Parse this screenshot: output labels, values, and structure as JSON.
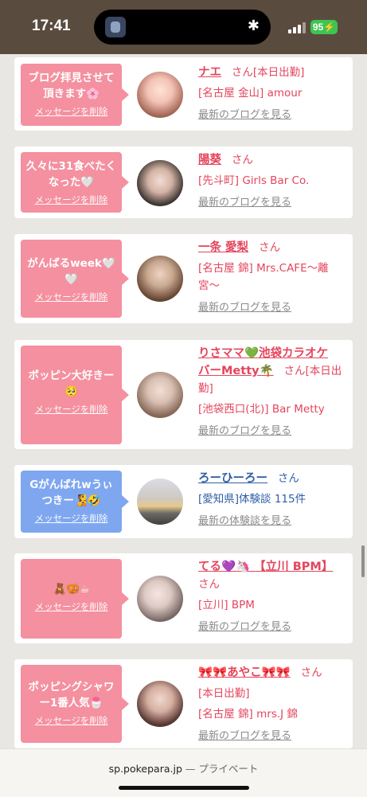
{
  "status_bar": {
    "time": "17:41",
    "battery": "95"
  },
  "cards": [
    {
      "message_lines": [
        "ブログ拝見させて",
        "頂きます🌸"
      ],
      "delete_label": "メッセージを削除",
      "message_color": "pink",
      "name_lines": [
        "ナエ"
      ],
      "honorific": "さん",
      "honorific_inline_text": "[本日出勤]",
      "details": [
        "[名古屋 金山] amour"
      ],
      "link": "最新のブログを見る"
    },
    {
      "message_lines": [
        "久々に31食べたく",
        "なった🤍"
      ],
      "delete_label": "メッセージを削除",
      "message_color": "pink",
      "name_lines": [
        "陽葵"
      ],
      "honorific": "さん",
      "details": [
        "[先斗町] Girls Bar Co."
      ],
      "link": "最新のブログを見る"
    },
    {
      "message_lines": [
        "がんばるweek🤍",
        "🤍"
      ],
      "delete_label": "メッセージを削除",
      "message_color": "pink",
      "name_lines": [
        "一条 愛梨"
      ],
      "honorific": "さん",
      "details": [
        "[名古屋 錦] Mrs.CAFE〜離",
        "宮〜"
      ],
      "link": "最新のブログを見る"
    },
    {
      "message_lines": [
        "ポッピン大好きー",
        "🥺"
      ],
      "delete_label": "メッセージを削除",
      "message_color": "pink",
      "name_lines": [
        "りさママ💚池袋カラオケ",
        "バーMetty🌴"
      ],
      "honorific": "さん",
      "honorific_inline_text": "[本日出",
      "details": [
        "勤]",
        "[池袋西口(北)] Bar Metty"
      ],
      "link": "最新のブログを見る"
    },
    {
      "message_lines": [
        "Gがんばれwうぃ",
        "つきー🧏🤣"
      ],
      "delete_label": "メッセージを削除",
      "message_color": "blue",
      "name_lines": [
        "ろーひーろー"
      ],
      "honorific": "さん",
      "details": [
        "[愛知県]体験談 115件"
      ],
      "link": "最新の体験談を見る"
    },
    {
      "message_lines": [
        "🧸🥨☕"
      ],
      "delete_label": "メッセージを削除",
      "message_color": "pink",
      "name_lines": [
        "てる💜🦄 【立川 BPM】"
      ],
      "honorific": "さん",
      "details": [
        "[立川] BPM"
      ],
      "link": "最新のブログを見る"
    },
    {
      "message_lines": [
        "ポッピングシャワ",
        "ー1番人気🍧"
      ],
      "delete_label": "メッセージを削除",
      "message_color": "pink",
      "name_lines": [
        "🎀🎀あやこ🎀🎀"
      ],
      "honorific": "さん",
      "details": [
        "[本日出勤]",
        "[名古屋 錦] mrs.J 錦"
      ],
      "link": "最新のブログを見る"
    }
  ],
  "browser": {
    "url": "sp.pokepara.jp",
    "separator": "—",
    "mode": "プライベート"
  }
}
